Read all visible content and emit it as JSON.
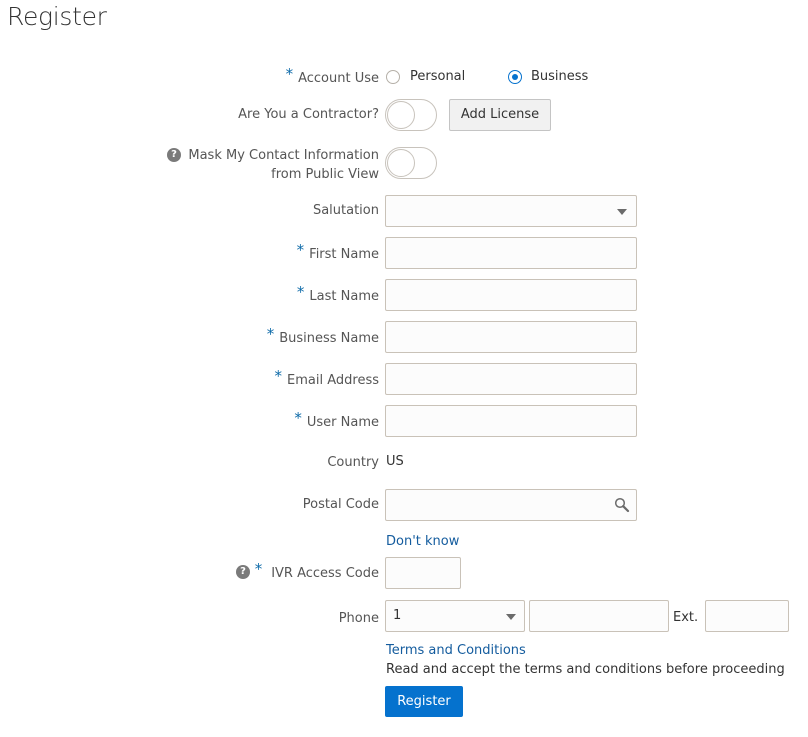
{
  "page": {
    "title": "Register"
  },
  "form": {
    "account_use": {
      "label": "Account Use",
      "required_marker": "*",
      "options": [
        {
          "label": "Personal",
          "selected": false
        },
        {
          "label": "Business",
          "selected": true
        }
      ]
    },
    "contractor": {
      "label": "Are You a Contractor?",
      "on": false,
      "add_license_label": "Add License"
    },
    "mask_contact": {
      "label_line1": "Mask My Contact Information",
      "label_line2": "from Public View",
      "help_icon": "question-circle-icon",
      "on": false
    },
    "salutation": {
      "label": "Salutation",
      "value": ""
    },
    "first_name": {
      "label": "First Name",
      "required_marker": "*",
      "value": ""
    },
    "last_name": {
      "label": "Last Name",
      "required_marker": "*",
      "value": ""
    },
    "business_name": {
      "label": "Business Name",
      "required_marker": "*",
      "value": ""
    },
    "email": {
      "label": "Email Address",
      "required_marker": "*",
      "value": ""
    },
    "user_name": {
      "label": "User Name",
      "required_marker": "*",
      "value": ""
    },
    "country": {
      "label": "Country",
      "value": "US"
    },
    "postal_code": {
      "label": "Postal Code",
      "value": "",
      "search_icon": "magnifier-icon",
      "dont_know_link": "Don't know"
    },
    "ivr": {
      "label": "IVR Access Code",
      "required_marker": "*",
      "help_icon": "question-circle-icon",
      "value": ""
    },
    "phone": {
      "label": "Phone",
      "country_code": "1",
      "number": "",
      "ext_label": "Ext.",
      "ext": ""
    },
    "terms": {
      "link": "Terms and Conditions",
      "note": "Read and accept the terms and conditions before proceeding"
    },
    "register_button": "Register"
  }
}
